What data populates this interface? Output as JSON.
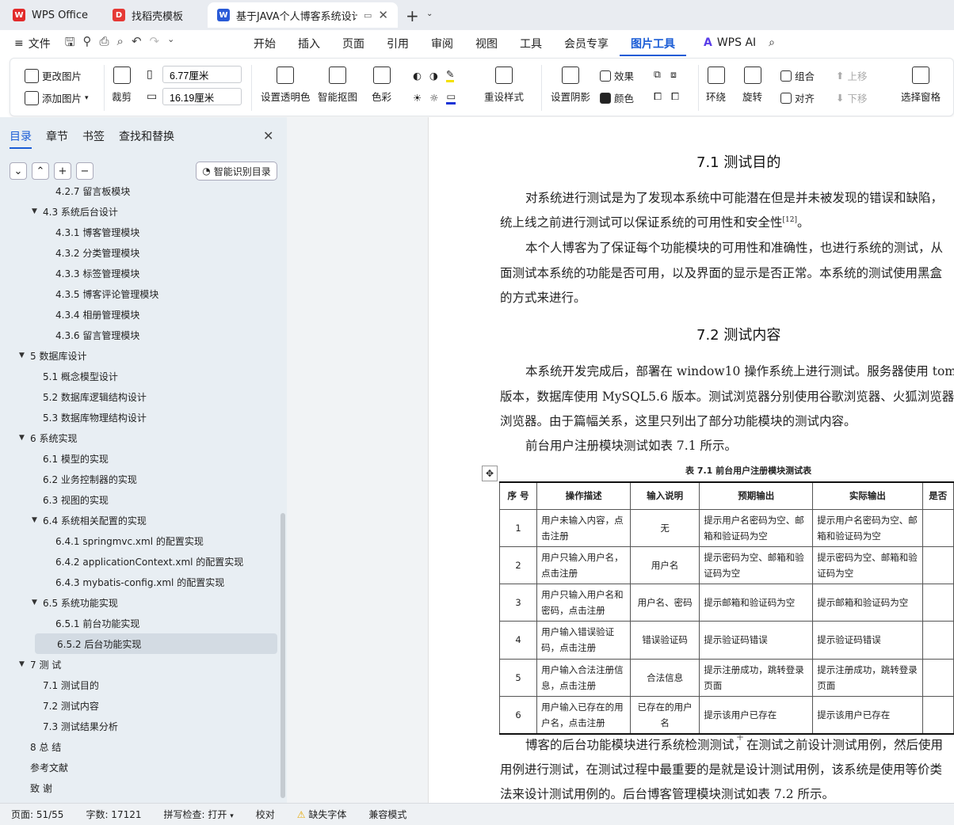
{
  "tabs": [
    {
      "label": "WPS Office",
      "icon": "wps-logo-icon",
      "color": "#e22b2b"
    },
    {
      "label": "找稻壳模板",
      "icon": "docer-logo-icon",
      "color": "#e53935"
    },
    {
      "label": "基于JAVA个人博客系统设计",
      "icon": "wps-writer-icon",
      "color": "#2a5bd7"
    }
  ],
  "menubar": {
    "file": "文件",
    "items": [
      "开始",
      "插入",
      "页面",
      "引用",
      "审阅",
      "视图",
      "工具",
      "会员专享",
      "图片工具"
    ],
    "active": "图片工具",
    "ai": "WPS AI"
  },
  "ribbon": {
    "change_image": "更改图片",
    "add_image": "添加图片",
    "crop": "裁剪",
    "width": "6.77厘米",
    "height": "16.19厘米",
    "set_transparent": "设置透明色",
    "smart_cutout": "智能抠图",
    "color_tone": "色彩",
    "reset_style": "重设样式",
    "set_shadow": "设置阴影",
    "effect": "效果",
    "color": "颜色",
    "wrap": "环绕",
    "rotate": "旋转",
    "group": "组合",
    "align": "对齐",
    "move_up": "上移",
    "move_down": "下移",
    "selection_pane": "选择窗格"
  },
  "left_panel": {
    "tabs": [
      "目录",
      "章节",
      "书签",
      "查找和替换"
    ],
    "active_tab": "目录",
    "smart_toc": "智能识别目录",
    "toc": [
      {
        "label": "4.2.7  留言板模块",
        "level": 3,
        "partial": true
      },
      {
        "label": "4.3  系统后台设计",
        "level": 2,
        "arrow": true
      },
      {
        "label": "4.3.1  博客管理模块",
        "level": 3
      },
      {
        "label": "4.3.2  分类管理模块",
        "level": 3
      },
      {
        "label": "4.3.3  标签管理模块",
        "level": 3
      },
      {
        "label": "4.3.5  博客评论管理模块",
        "level": 3
      },
      {
        "label": "4.3.4  相册管理模块",
        "level": 3
      },
      {
        "label": "4.3.6  留言管理模块",
        "level": 3
      },
      {
        "label": "5  数据库设计",
        "level": 1,
        "arrow": true
      },
      {
        "label": "5.1  概念模型设计",
        "level": 2
      },
      {
        "label": "5.2  数据库逻辑结构设计",
        "level": 2
      },
      {
        "label": "5.3  数据库物理结构设计",
        "level": 2
      },
      {
        "label": "6  系统实现",
        "level": 1,
        "arrow": true
      },
      {
        "label": "6.1  模型的实现",
        "level": 2
      },
      {
        "label": "6.2  业务控制器的实现",
        "level": 2
      },
      {
        "label": "6.3  视图的实现",
        "level": 2
      },
      {
        "label": "6.4  系统相关配置的实现",
        "level": 2,
        "arrow": true
      },
      {
        "label": "6.4.1 springmvc.xml 的配置实现",
        "level": 3
      },
      {
        "label": "6.4.2 applicationContext.xml 的配置实现",
        "level": 3
      },
      {
        "label": "6.4.3 mybatis-config.xml 的配置实现",
        "level": 3
      },
      {
        "label": "6.5  系统功能实现",
        "level": 2,
        "arrow": true
      },
      {
        "label": "6.5.1  前台功能实现",
        "level": 3
      },
      {
        "label": "6.5.2  后台功能实现",
        "level": 3,
        "selected": true
      },
      {
        "label": "7  测      试",
        "level": 1,
        "arrow": true
      },
      {
        "label": "7.1  测试目的",
        "level": 2
      },
      {
        "label": "7.2  测试内容",
        "level": 2
      },
      {
        "label": "7.3  测试结果分析",
        "level": 2
      },
      {
        "label": "8  总      结",
        "level": 1
      },
      {
        "label": "参考文献",
        "level": 1
      },
      {
        "label": "致      谢",
        "level": 1
      }
    ]
  },
  "document": {
    "h71": "7.1  测试目的",
    "p1a": "对系统进行测试是为了发现本系统中可能潜在但是并未被发现的错误和缺陷，",
    "p1b": "统上线之前进行测试可以保证系统的可用性和安全性",
    "p1b_ref": "[12]",
    "p1b_end": "。",
    "p2a": "本个人博客为了保证每个功能模块的可用性和准确性，也进行系统的测试，从",
    "p2b": "面测试本系统的功能是否可用，以及界面的显示是否正常。本系统的测试使用黑盒",
    "p2c": "的方式来进行。",
    "h72": "7.2  测试内容",
    "p3a": "本系统开发完成后，部署在 window10 操作系统上进行测试。服务器使用 tom",
    "p3b": "版本，数据库使用 MySQL5.6 版本。测试浏览器分别使用谷歌浏览器、火狐浏览器",
    "p3c": "浏览器。由于篇幅关系，这里只列出了部分功能模块的测试内容。",
    "p4": "前台用户注册模块测试如表 7.1 所示。",
    "table_caption": "表 7.1  前台用户注册模块测试表",
    "table_headers": [
      "序 号",
      "操作描述",
      "输入说明",
      "预期输出",
      "实际输出",
      "是否"
    ],
    "table_rows": [
      [
        "1",
        "用户未输入内容，点击注册",
        "无",
        "提示用户名密码为空、邮箱和验证码为空",
        "提示用户名密码为空、邮箱和验证码为空",
        ""
      ],
      [
        "2",
        "用户只输入用户名，点击注册",
        "用户名",
        "提示密码为空、邮箱和验证码为空",
        "提示密码为空、邮箱和验证码为空",
        ""
      ],
      [
        "3",
        "用户只输入用户名和密码，点击注册",
        "用户名、密码",
        "提示邮箱和验证码为空",
        "提示邮箱和验证码为空",
        ""
      ],
      [
        "4",
        "用户输入错误验证码，点击注册",
        "错误验证码",
        "提示验证码错误",
        "提示验证码错误",
        ""
      ],
      [
        "5",
        "用户输入合法注册信息，点击注册",
        "合法信息",
        "提示注册成功，跳转登录页面",
        "提示注册成功，跳转登录页面",
        ""
      ],
      [
        "6",
        "用户输入已存在的用户名，点击注册",
        "已存在的用户名",
        "提示该用户已存在",
        "提示该用户已存在",
        ""
      ]
    ],
    "p5a": "博客的后台功能模块进行系统检测测试，在测试之前设计测试用例，然后使用",
    "p5b": "用例进行测试，在测试过程中最重要的是就是设计测试用例，该系统是使用等价类",
    "p5c": "法来设计测试用例的。后台博客管理模块测试如表 7.2 所示。"
  },
  "status": {
    "page": "页面: 51/55",
    "words": "字数: 17121",
    "spell": "拼写检查: 打开",
    "proof": "校对",
    "missing_font": "缺失字体",
    "compat": "兼容模式"
  }
}
